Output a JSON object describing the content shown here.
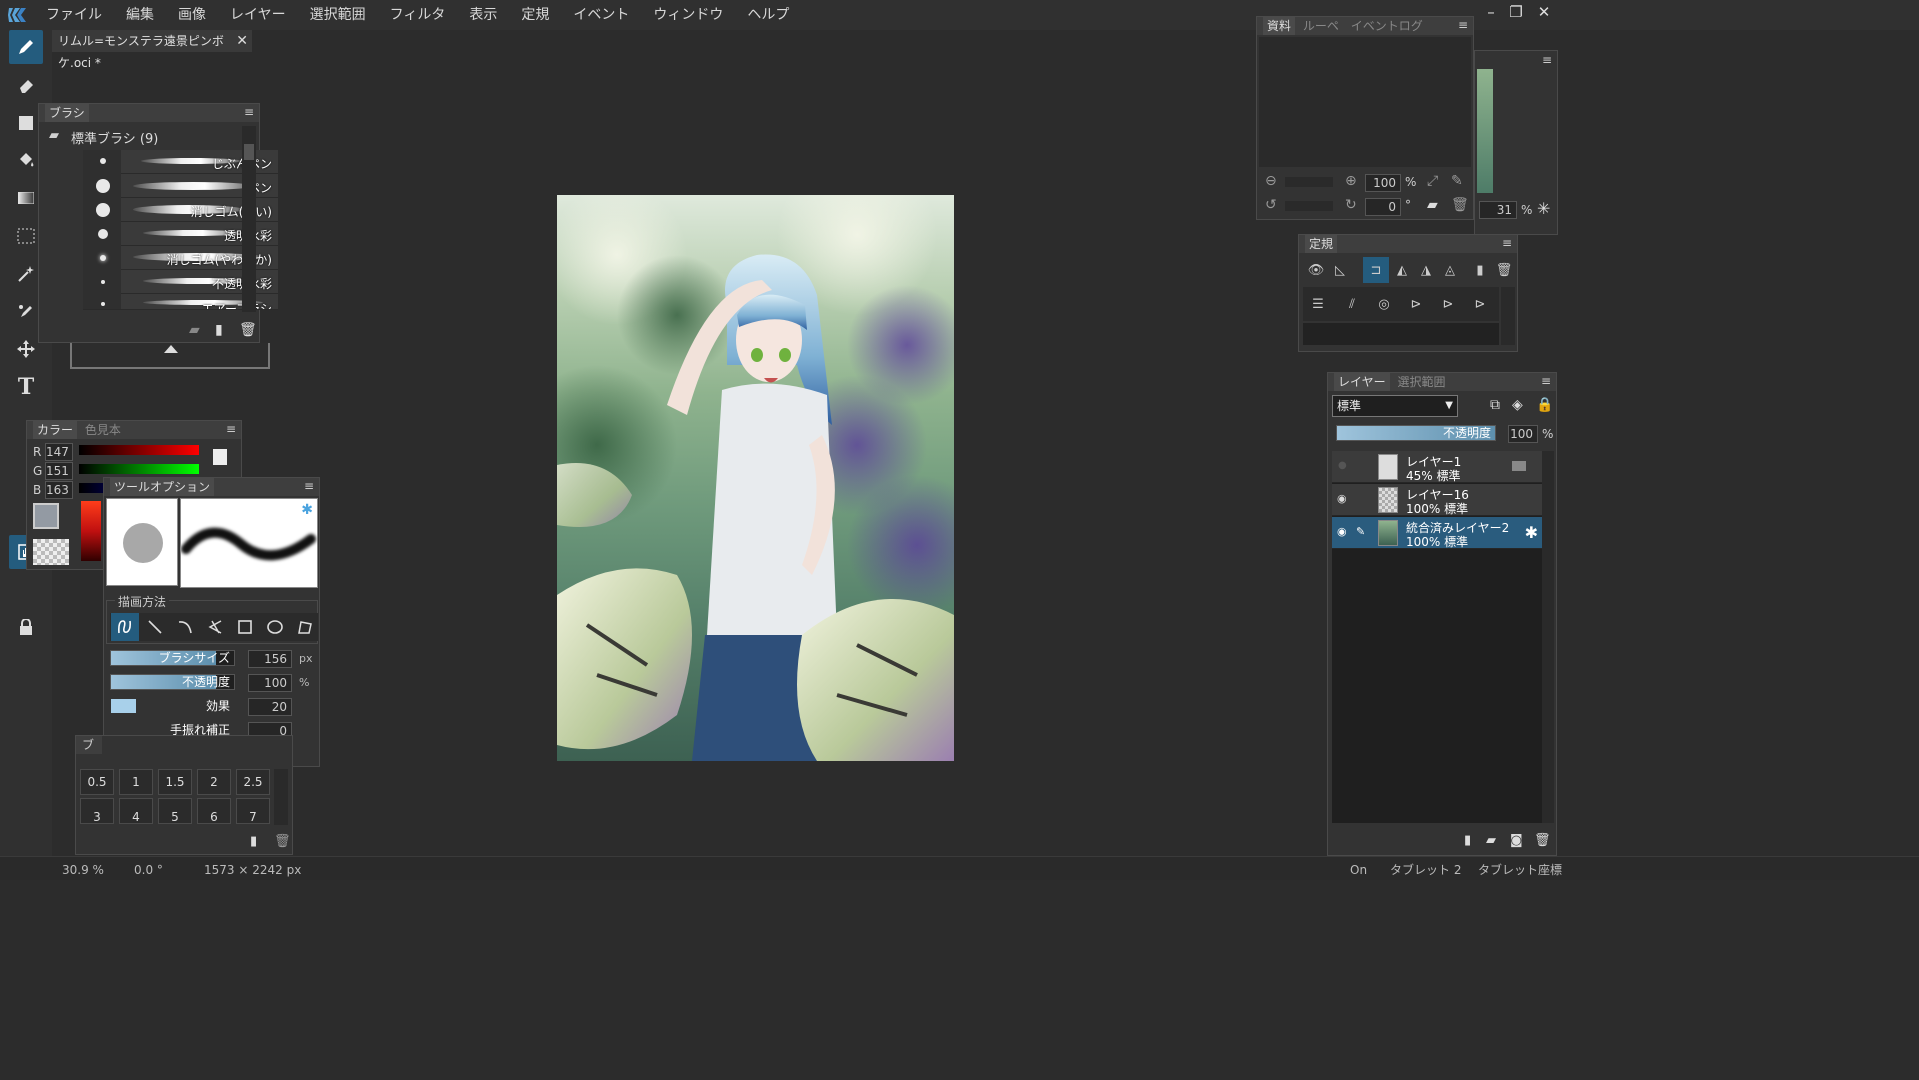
{
  "menubar": {
    "items": [
      "ファイル",
      "編集",
      "画像",
      "レイヤー",
      "選択範囲",
      "フィルタ",
      "表示",
      "定規",
      "イベント",
      "ウィンドウ",
      "ヘルプ"
    ],
    "minimize": "–",
    "restore": "❐",
    "close": "✕"
  },
  "document": {
    "tab_title": "リムル=モンステラ遠景ピンボケ.oci *",
    "tab_close": "✕"
  },
  "brush_panel": {
    "title": "ブラシ",
    "group_label": "標準ブラシ (9)",
    "brushes": [
      "じぶんペン",
      "ペン",
      "消しゴム(硬い)",
      "透明水彩",
      "消しゴム(やわらか)",
      "不透明水彩",
      "エアーブラシ"
    ]
  },
  "color_panel": {
    "tabs": [
      "カラー",
      "色見本"
    ],
    "r_label": "R",
    "r_value": "147",
    "g_label": "G",
    "g_value": "151",
    "b_label": "B",
    "b_value": "163",
    "current_color": "#939aa3"
  },
  "tool_options": {
    "title": "ツールオプション",
    "section_label": "描画方法",
    "brush_size_label": "ブラシサイズ",
    "brush_size_value": "156",
    "brush_size_unit": "px",
    "brush_size_level": 0.85,
    "opacity_label": "不透明度",
    "opacity_value": "100",
    "opacity_unit": "%",
    "opacity_level": 0.85,
    "effect_label": "効果",
    "effect_value": "20",
    "effect_level": 0.2,
    "stabilizer_label": "手振れ補正",
    "stabilizer_value": "0"
  },
  "size_panel": {
    "title": "ブラシサイズ",
    "sizes": [
      "0.5",
      "1",
      "1.5",
      "2",
      "2.5",
      "3",
      "4",
      "5",
      "6",
      "7"
    ]
  },
  "reference_panel": {
    "tabs": [
      "資料",
      "ルーペ",
      "イベントログ"
    ],
    "zoom_value": "100",
    "zoom_unit": "%",
    "rotate_value": "0",
    "rotate_unit": "°"
  },
  "navigator": {
    "zoom_value": "31",
    "zoom_unit": "%"
  },
  "ruler_panel": {
    "title": "定規"
  },
  "layer_panel": {
    "tabs": [
      "レイヤー",
      "選択範囲"
    ],
    "blend_mode": "標準",
    "opacity_label": "不透明度",
    "opacity_value": "100",
    "opacity_unit": "%",
    "layers": [
      {
        "name": "レイヤー1",
        "info": "45% 標準"
      },
      {
        "name": "レイヤー16",
        "info": "100% 標準"
      },
      {
        "name": "統合済みレイヤー2",
        "info": "100% 標準"
      }
    ]
  },
  "status_bar": {
    "zoom": "30.9 %",
    "angle": "0.0 °",
    "canvas_size": "1573 × 2242 px",
    "pen_state": "On",
    "tablet": "タブレット 2",
    "coord_mode": "タブレット座標"
  },
  "colors": {
    "accent": "#245c7e",
    "bg": "#2c2c2c",
    "panel": "#333333"
  }
}
